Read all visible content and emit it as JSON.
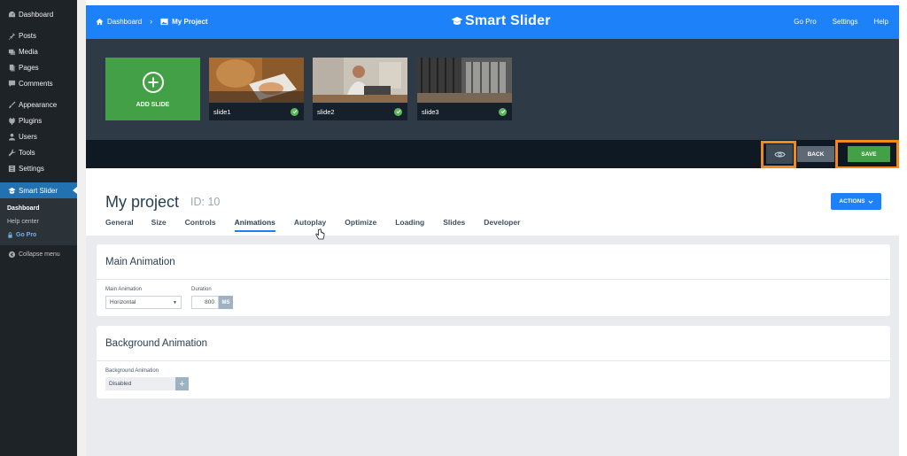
{
  "wp_menu": {
    "items": [
      {
        "label": "Dashboard",
        "icon": "dashboard-icon"
      },
      {
        "label": "Posts",
        "icon": "pin-icon"
      },
      {
        "label": "Media",
        "icon": "media-icon"
      },
      {
        "label": "Pages",
        "icon": "pages-icon"
      },
      {
        "label": "Comments",
        "icon": "comments-icon"
      },
      {
        "label": "Appearance",
        "icon": "brush-icon"
      },
      {
        "label": "Plugins",
        "icon": "plug-icon"
      },
      {
        "label": "Users",
        "icon": "users-icon"
      },
      {
        "label": "Tools",
        "icon": "wrench-icon"
      },
      {
        "label": "Settings",
        "icon": "settings-icon"
      },
      {
        "label": "Smart Slider",
        "icon": "smart-slider-icon"
      }
    ],
    "submenu": {
      "dashboard": "Dashboard",
      "help_center": "Help center",
      "go_pro": "Go Pro"
    },
    "collapse": "Collapse menu"
  },
  "topbar": {
    "breadcrumb_home": "Dashboard",
    "breadcrumb_project": "My Project",
    "logo": "Smart Slider",
    "links": [
      "Go Pro",
      "Settings",
      "Help"
    ]
  },
  "slides": {
    "add_label": "ADD SLIDE",
    "items": [
      {
        "name": "slide1"
      },
      {
        "name": "slide2"
      },
      {
        "name": "slide3"
      }
    ]
  },
  "toolbar": {
    "back_label": "BACK",
    "save_label": "SAVE"
  },
  "project": {
    "title": "My project",
    "id_label": "ID: 10",
    "actions_label": "ACTIONS",
    "tabs": [
      "General",
      "Size",
      "Controls",
      "Animations",
      "Autoplay",
      "Optimize",
      "Loading",
      "Slides",
      "Developer"
    ],
    "active_tab": "Animations"
  },
  "main_animation": {
    "title": "Main Animation",
    "animation_label": "Main Animation",
    "animation_value": "Horizontal",
    "duration_label": "Duration",
    "duration_value": "800",
    "duration_unit": "MS"
  },
  "background_animation": {
    "title": "Background Animation",
    "field_label": "Background Animation",
    "field_value": "Disabled"
  },
  "colors": {
    "wp_sidebar": "#1d2327",
    "wp_active": "#2271b1",
    "topbar": "#1d81f9",
    "slides_bg": "#2e3b47",
    "toolbar_bg": "#0f1923",
    "save": "#43a047",
    "highlight": "#f08a1c"
  }
}
